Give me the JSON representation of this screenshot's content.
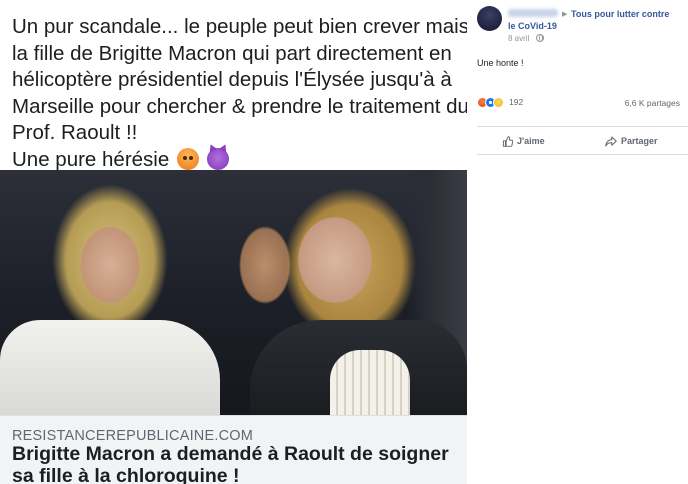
{
  "shared_image": {
    "caption_lines": [
      "Un pur scandale... le peuple peut bien crever mais pas",
      "la fille de Brigitte Macron qui part directement en",
      "hélicoptère présidentiel depuis l'Élysée jusqu'à à",
      "Marseille pour chercher & prendre le traitement du",
      "Prof. Raoult !!",
      "Une pure hérésie"
    ],
    "caption_emojis": [
      "angry-face-emoji",
      "smiling-devil-emoji"
    ],
    "link_domain": "RESISTANCEREPUBLICAINE.COM",
    "link_title": "Brigitte Macron a demandé à Raoult de soigner sa fille à la chloroquine !"
  },
  "post": {
    "group_name": "Tous pour lutter contre",
    "group_name_cont": "le CoVid-19",
    "date": "8 avril",
    "text": "Une honte !",
    "reaction_count": "192",
    "reaction_icons": [
      "angry-react-icon",
      "like-react-icon",
      "haha-react-icon"
    ],
    "shares": "6,6 K partages",
    "actions": {
      "like": "J'aime",
      "share": "Partager"
    }
  },
  "colors": {
    "link_blue": "#385898",
    "meta_gray": "#90949c",
    "action_gray": "#606770",
    "preview_bg": "#f2f3f5"
  }
}
